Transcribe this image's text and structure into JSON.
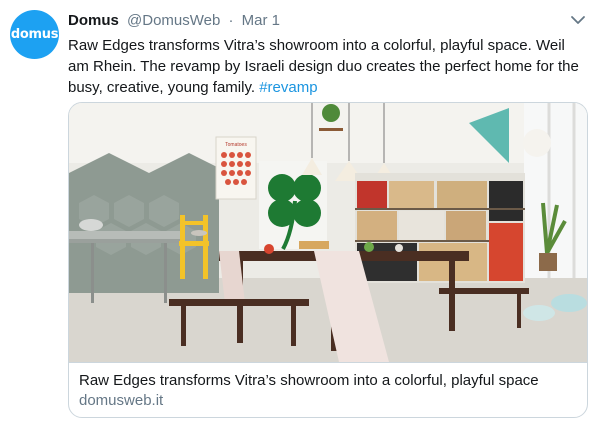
{
  "avatar": {
    "text": "domus",
    "color": "#1da1f2"
  },
  "header": {
    "name": "Domus",
    "handle": "@DomusWeb",
    "separator": "·",
    "date": "Mar 1"
  },
  "tweet": {
    "text": "Raw Edges transforms Vitra’s showroom into a colorful, playful space. Weil am Rhein. The revamp by Israeli design duo creates the perfect home for the busy, creative, young family. ",
    "hashtag": "#revamp",
    "hashtag_color": "#1b95e0"
  },
  "card": {
    "title": "Raw Edges transforms Vitra’s showroom into a colorful, playful space",
    "domain": "domusweb.it",
    "poster_title": "Tomatoes"
  },
  "icons": {
    "menu": "chevron-down-icon"
  }
}
